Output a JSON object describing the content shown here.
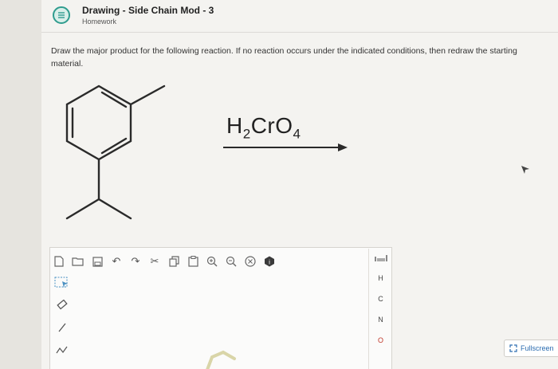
{
  "header": {
    "title": "Drawing - Side Chain Mod - 3",
    "subtitle": "Homework",
    "icon": "list-icon"
  },
  "question": {
    "text": "Draw the major product for the following reaction. If no reaction occurs under the indicated conditions, then redraw the starting material."
  },
  "reaction": {
    "reagent_main": "H",
    "reagent_sub1": "2",
    "reagent_mid": "CrO",
    "reagent_sub2": "4"
  },
  "toolbar": {
    "icons": [
      "new-document-icon",
      "open-folder-icon",
      "save-icon",
      "undo-icon",
      "redo-icon",
      "cut-icon",
      "copy-icon",
      "paste-icon",
      "zoom-in-icon",
      "zoom-out-icon",
      "clear-icon",
      "info-icon"
    ]
  },
  "element_panel": {
    "elements": [
      "H",
      "C",
      "N",
      "O"
    ],
    "colors": {
      "O": "#c0392b"
    }
  },
  "fullscreen": {
    "label": "Fullscreen"
  }
}
